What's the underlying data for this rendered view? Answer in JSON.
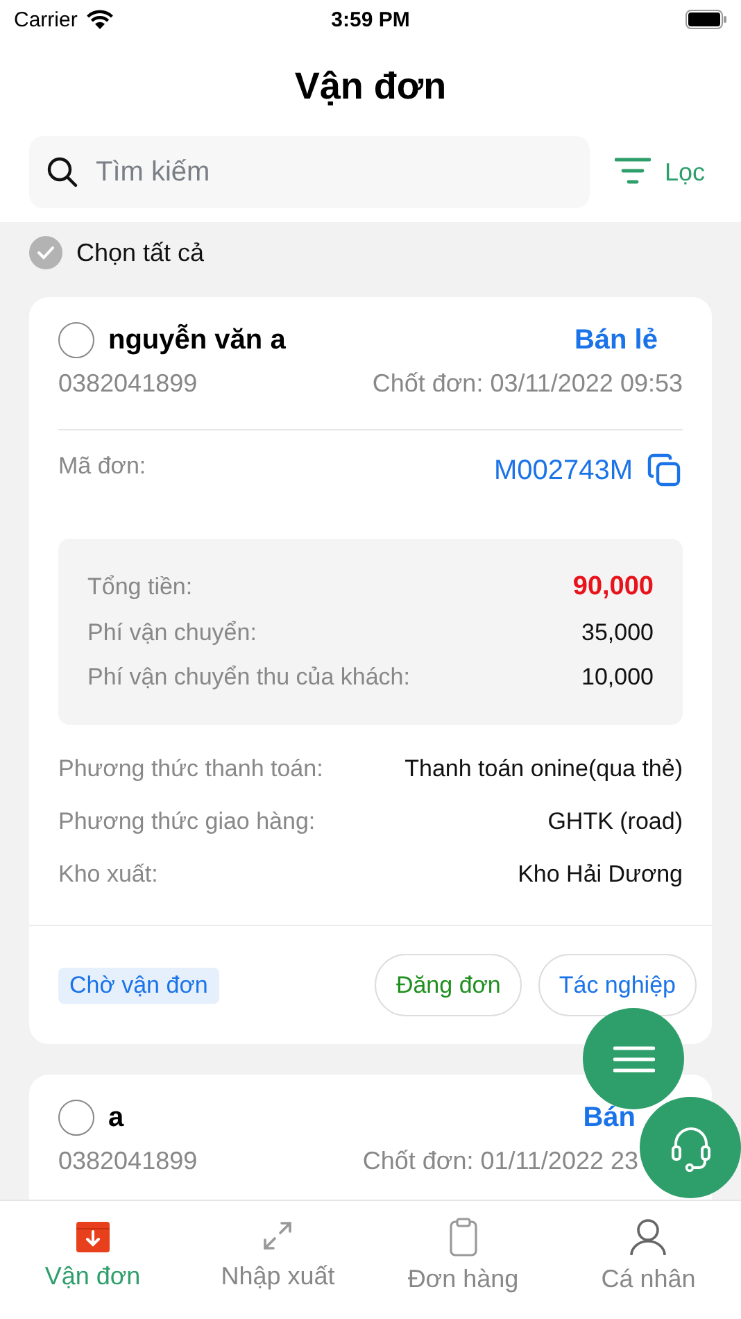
{
  "status_bar": {
    "carrier": "Carrier",
    "time": "3:59 PM"
  },
  "header": {
    "title": "Vận đơn"
  },
  "search": {
    "placeholder": "Tìm kiếm"
  },
  "filter_button": {
    "label": "Lọc"
  },
  "select_all": {
    "label": "Chọn tất cả",
    "checked": true
  },
  "orders": [
    {
      "checked": false,
      "customer": "nguyễn văn a",
      "type": "Bán lẻ",
      "phone": "0382041899",
      "closed_at": "Chốt đơn: 03/11/2022 09:53",
      "code_label": "Mã đơn:",
      "code": "M002743M",
      "totals": [
        {
          "label": "Tổng tiền:",
          "value": "90,000",
          "kind": "total"
        },
        {
          "label": "Phí vận chuyển:",
          "value": "35,000",
          "kind": "fee"
        },
        {
          "label": "Phí vận chuyển thu của khách:",
          "value": "10,000",
          "kind": "fee"
        }
      ],
      "details": [
        {
          "label": "Phương thức thanh toán:",
          "value": "Thanh toán onine(qua thẻ)"
        },
        {
          "label": "Phương thức giao hàng:",
          "value": "GHTK (road)"
        },
        {
          "label": "Kho xuất:",
          "value": "Kho Hải Dương"
        }
      ],
      "status": "Chờ vận đơn",
      "actions": [
        {
          "label": "Đăng đơn",
          "kind": "post"
        },
        {
          "label": "Tác nghiệp",
          "kind": "process"
        }
      ]
    },
    {
      "checked": false,
      "customer": "a",
      "type": "Bán",
      "phone": "0382041899",
      "closed_at": "Chốt đơn: 01/11/2022 23"
    }
  ],
  "tab_bar": [
    {
      "label": "Vận đơn",
      "kind": "waybill",
      "selected": true
    },
    {
      "label": "Nhập xuất",
      "kind": "transfer",
      "selected": false
    },
    {
      "label": "Đơn hàng",
      "kind": "orders",
      "selected": false
    },
    {
      "label": "Cá nhân",
      "kind": "profile",
      "selected": false
    }
  ]
}
